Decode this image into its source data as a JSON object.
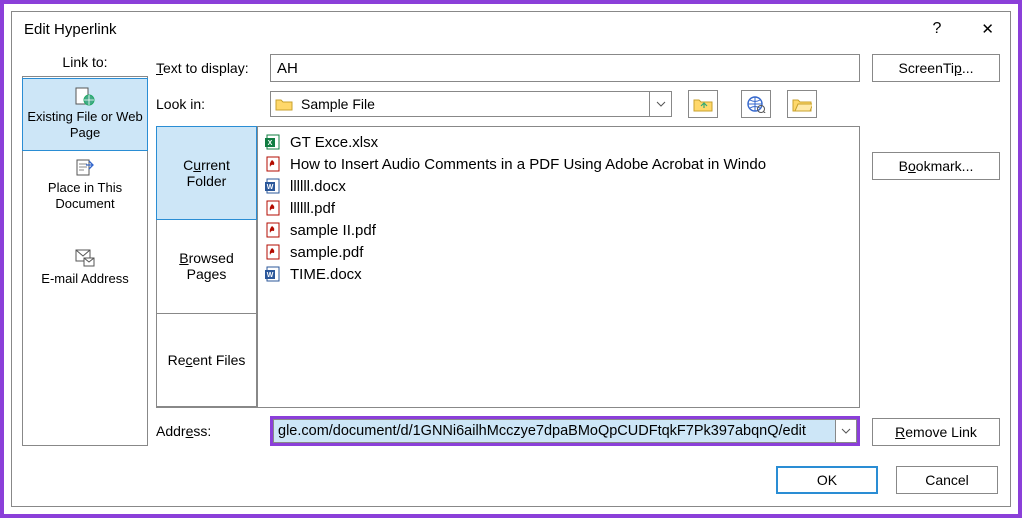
{
  "title": "Edit Hyperlink",
  "help_symbol": "?",
  "close_symbol": "✕",
  "linkto": {
    "header": "Link to:",
    "items": [
      {
        "label": "Existing File or Web Page",
        "selected": true,
        "icon": "file-globe-icon"
      },
      {
        "label": "Place in This Document",
        "selected": false,
        "icon": "place-doc-icon"
      },
      {
        "label": "",
        "selected": false,
        "icon": "spacer"
      },
      {
        "label": "E-mail Address",
        "selected": false,
        "icon": "email-icon"
      }
    ]
  },
  "text_to_display_label": "Text to display:",
  "text_to_display_value": "AH",
  "look_in_label": "Look in:",
  "look_in_value": "Sample File",
  "browse_tabs": [
    {
      "label": "Current Folder",
      "selected": true
    },
    {
      "label": "Browsed Pages",
      "selected": false
    },
    {
      "label": "Recent Files",
      "selected": false
    }
  ],
  "browse_tab_labels": {
    "tab0_line1": "Current",
    "tab0_line2": "Folder",
    "tab1_line1": "Browsed",
    "tab1_line2": "Pages",
    "tab2_line1": "Recent Files"
  },
  "files": [
    {
      "name": "GT Exce.xlsx",
      "icon": "xlsx"
    },
    {
      "name": "How to Insert Audio Comments in a PDF Using Adobe Acrobat in Windo",
      "icon": "pdf"
    },
    {
      "name": "llllll.docx",
      "icon": "docx"
    },
    {
      "name": "llllll.pdf",
      "icon": "pdf"
    },
    {
      "name": "sample II.pdf",
      "icon": "pdf"
    },
    {
      "name": "sample.pdf",
      "icon": "pdf"
    },
    {
      "name": "TIME.docx",
      "icon": "docx"
    }
  ],
  "address_label": "Address:",
  "address_value": "gle.com/document/d/1GNNi6ailhMcczye7dpaBMoQpCUDFtqkF7Pk397abqnQ/edit",
  "buttons": {
    "screentip": "ScreenTip...",
    "bookmark": "Bookmark...",
    "remove_link": "Remove Link",
    "ok": "OK",
    "cancel": "Cancel"
  },
  "icons": {
    "up_folder": "up-folder-icon",
    "web_browse": "web-browse-icon",
    "open_folder": "open-folder-icon"
  }
}
